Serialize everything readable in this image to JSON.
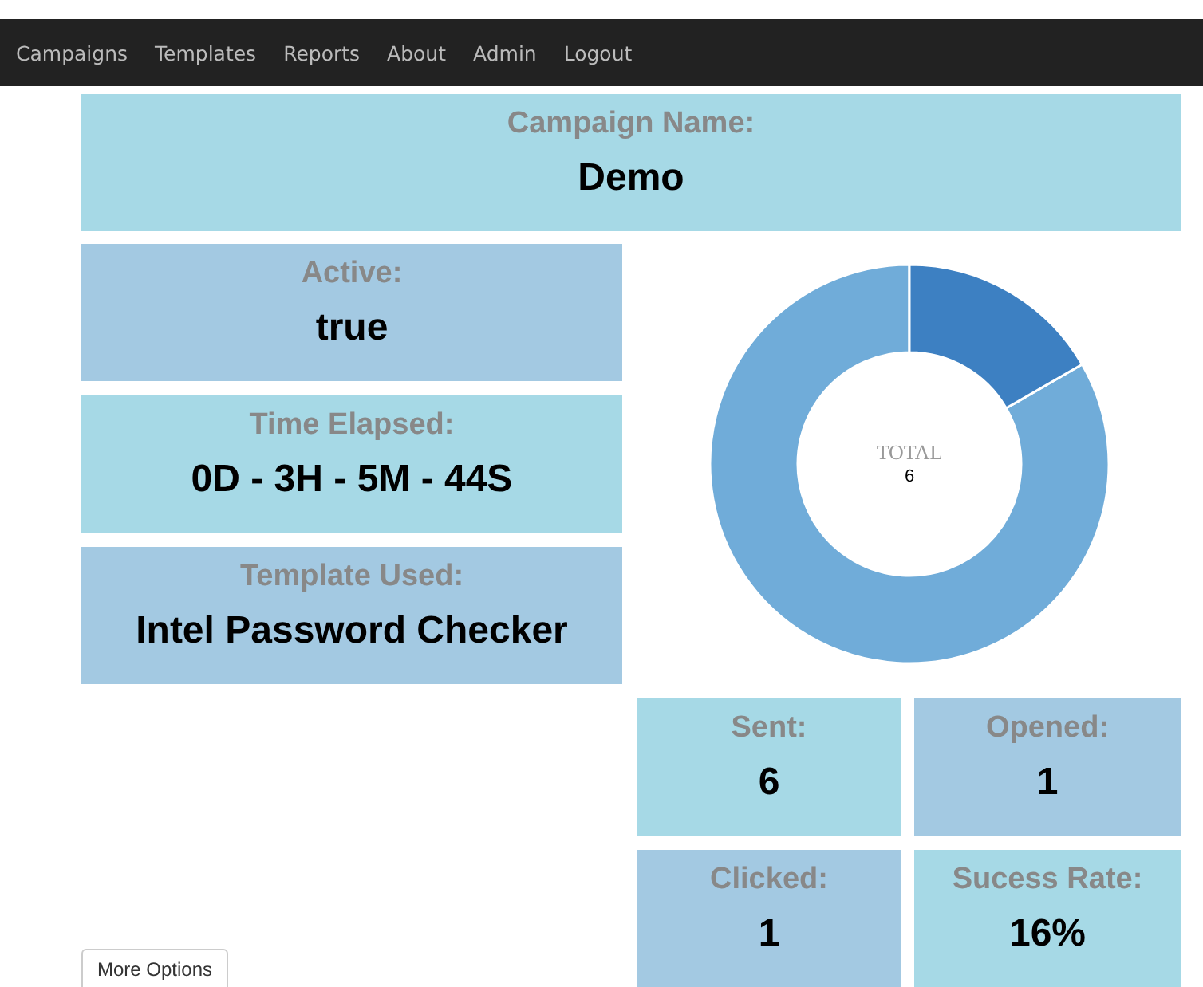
{
  "nav": {
    "items": [
      "Campaigns",
      "Templates",
      "Reports",
      "About",
      "Admin",
      "Logout"
    ]
  },
  "campaign": {
    "label": "Campaign Name:",
    "value": "Demo",
    "color": "#a6d9e6"
  },
  "details": [
    {
      "label": "Active:",
      "value": "true",
      "color": "#a3c9e2"
    },
    {
      "label": "Time Elapsed:",
      "value": "0D - 3H - 5M - 44S",
      "color": "#a6d9e6"
    },
    {
      "label": "Template Used:",
      "value": "Intel Password Checker",
      "color": "#a3c9e2"
    }
  ],
  "donut": {
    "center_label": "TOTAL",
    "center_value": "6"
  },
  "stats": [
    {
      "label": "Sent:",
      "value": "6",
      "color": "#a6d9e6"
    },
    {
      "label": "Opened:",
      "value": "1",
      "color": "#a3c9e2"
    },
    {
      "label": "Clicked:",
      "value": "1",
      "color": "#a3c9e2"
    },
    {
      "label": "Sucess Rate:",
      "value": "16%",
      "color": "#a6d9e6"
    }
  ],
  "more_button": "More Options"
}
